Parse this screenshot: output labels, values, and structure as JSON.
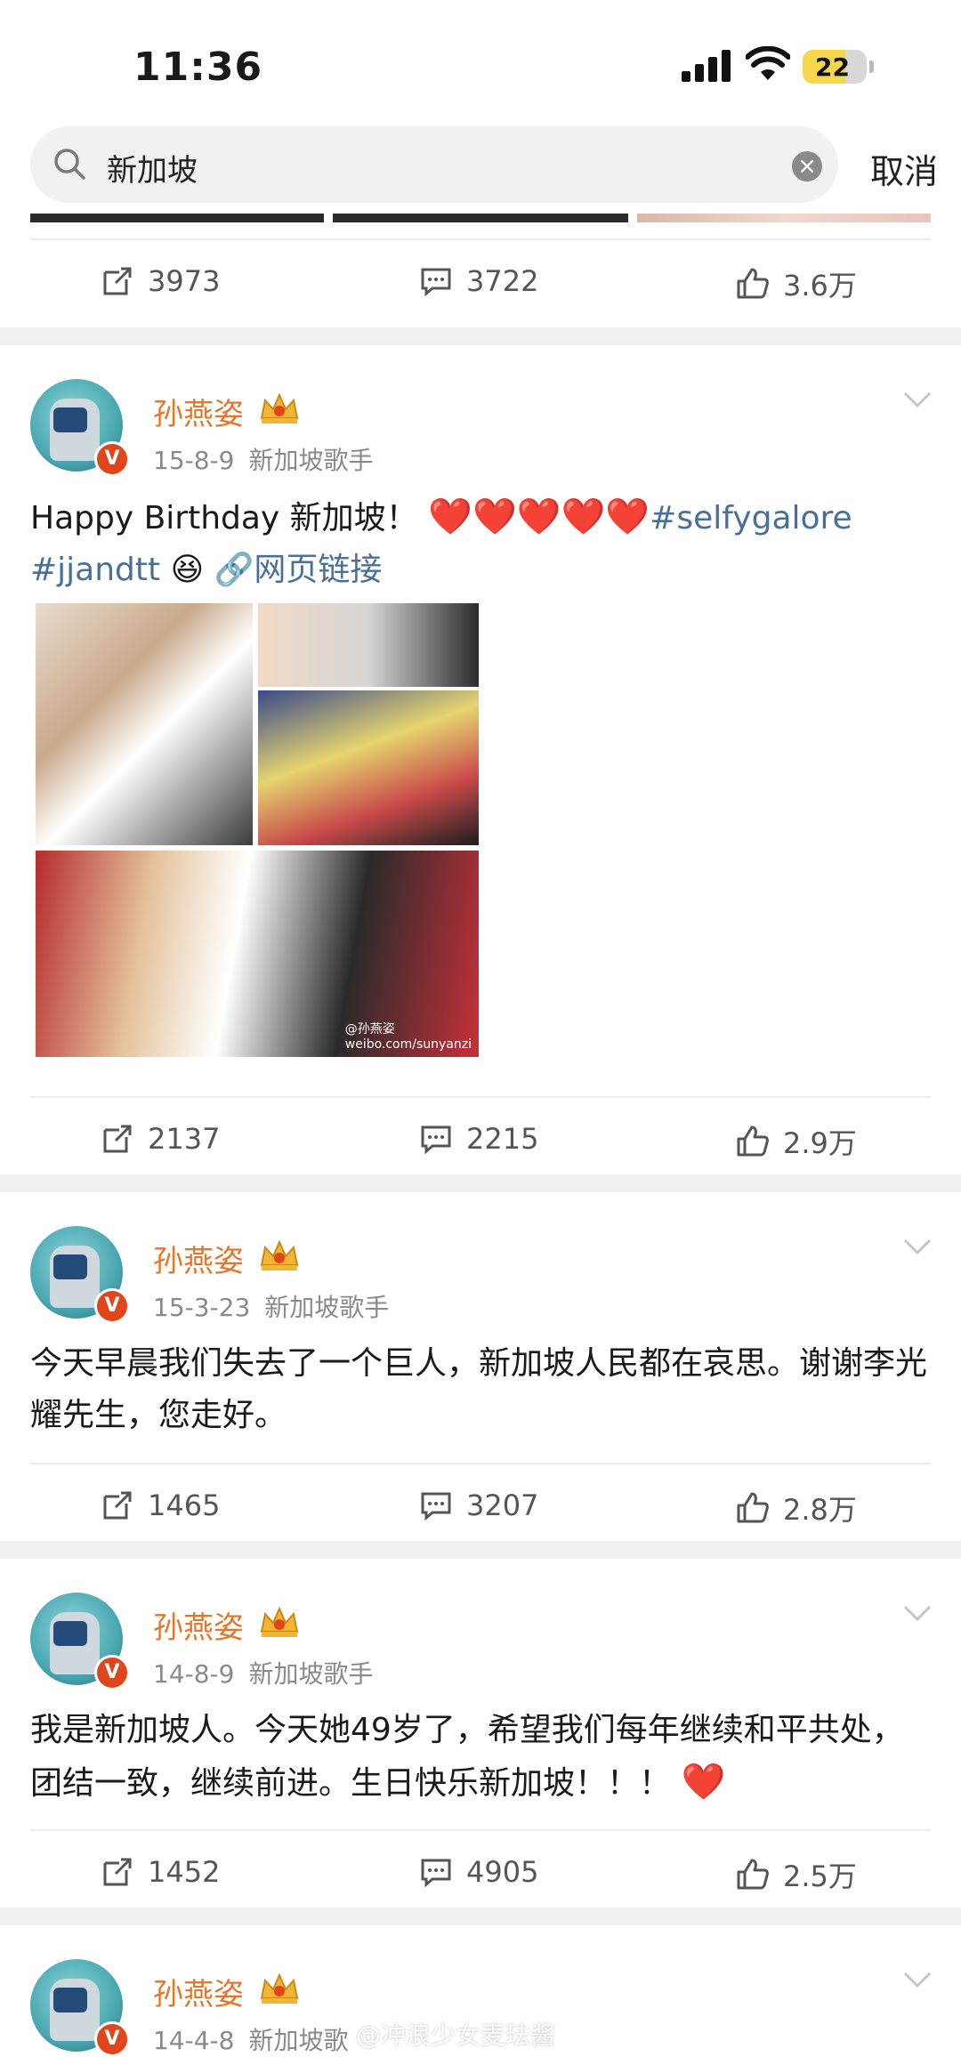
{
  "status_bar": {
    "time": "11:36",
    "battery": "22",
    "battery_level": 0.22
  },
  "search": {
    "query": "新加坡",
    "cancel_label": "取消"
  },
  "top_card": {
    "actions": {
      "repost": "3973",
      "comment": "3722",
      "like": "3.6万"
    }
  },
  "posts": [
    {
      "username": "孙燕姿",
      "date": "15-8-9",
      "source": "新加坡歌手",
      "verified_badge": "V",
      "text_part1": "Happy Birthday 新加坡！",
      "hearts": "❤️❤️❤️❤️❤️",
      "hashtag1": "#selfygalore",
      "hashtag2": "#jjandtt",
      "emoji": "😆",
      "weblink_label": "网页链接",
      "image_watermark_line1": "@孙燕姿",
      "image_watermark_line2": "weibo.com/sunyanzi",
      "actions": {
        "repost": "2137",
        "comment": "2215",
        "like": "2.9万"
      }
    },
    {
      "username": "孙燕姿",
      "date": "15-3-23",
      "source": "新加坡歌手",
      "verified_badge": "V",
      "text": "今天早晨我们失去了一个巨人，新加坡人民都在哀思。谢谢李光耀先生，您走好。",
      "actions": {
        "repost": "1465",
        "comment": "3207",
        "like": "2.8万"
      }
    },
    {
      "username": "孙燕姿",
      "date": "14-8-9",
      "source": "新加坡歌手",
      "verified_badge": "V",
      "text": "我是新加坡人。今天她49岁了，希望我们每年继续和平共处，团结一致，继续前进。生日快乐新加坡！！！",
      "heart": "❤️",
      "actions": {
        "repost": "1452",
        "comment": "4905",
        "like": "2.5万"
      }
    },
    {
      "username": "孙燕姿",
      "date": "14-4-8",
      "source": "新加坡歌",
      "verified_badge": "V"
    }
  ],
  "watermark": "@冲浪少女麦珐酱",
  "colors": {
    "username": "#e5752b",
    "link": "#4a6f98",
    "heart": "#e0242c",
    "badge": "#e0461c"
  }
}
